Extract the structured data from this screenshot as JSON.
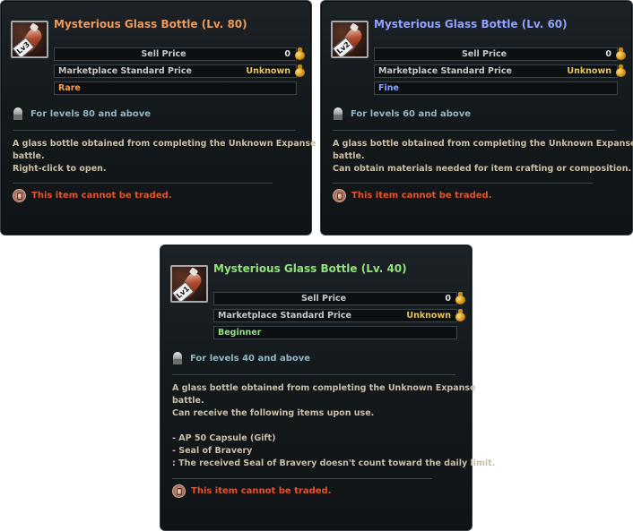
{
  "tooltips": [
    {
      "icon_badge": "Lv3",
      "title": "Mysterious Glass Bottle (Lv. 80)",
      "title_color": "#ef9a5b",
      "sell_price_label": "Sell Price",
      "sell_price_value": "0",
      "market_label": "Marketplace Standard Price",
      "market_value": "Unknown",
      "grade": "Rare",
      "grade_color": "#f0a05a",
      "level_text": "For levels 80 and above",
      "description": [
        "A glass bottle obtained from completing the Unknown Expanse",
        "battle.",
        "Right-click to open."
      ],
      "trade_text": "This item cannot be traded."
    },
    {
      "icon_badge": "Lv2",
      "title": "Mysterious Glass Bottle (Lv. 60)",
      "title_color": "#8fa3ff",
      "sell_price_label": "Sell Price",
      "sell_price_value": "0",
      "market_label": "Marketplace Standard Price",
      "market_value": "Unknown",
      "grade": "Fine",
      "grade_color": "#8aa3ff",
      "level_text": "For levels 60 and above",
      "description": [
        "A glass bottle obtained from completing the Unknown Expanse",
        "battle.",
        "Can obtain materials needed for item crafting or composition."
      ],
      "trade_text": "This item cannot be traded."
    },
    {
      "icon_badge": "Lv1",
      "title": "Mysterious Glass Bottle (Lv. 40)",
      "title_color": "#8fe37a",
      "sell_price_label": "Sell Price",
      "sell_price_value": "0",
      "market_label": "Marketplace Standard Price",
      "market_value": "Unknown",
      "grade": "Beginner",
      "grade_color": "#8fe37a",
      "level_text": "For levels 40 and above",
      "description": [
        "A glass bottle obtained from completing the Unknown Expanse",
        "battle.",
        "Can receive the following items upon use.",
        "",
        "- AP 50 Capsule (Gift)",
        "- Seal of Bravery",
        ": The received Seal of Bravery doesn't count toward the daily limit."
      ],
      "trade_text": "This item cannot be traded."
    }
  ]
}
